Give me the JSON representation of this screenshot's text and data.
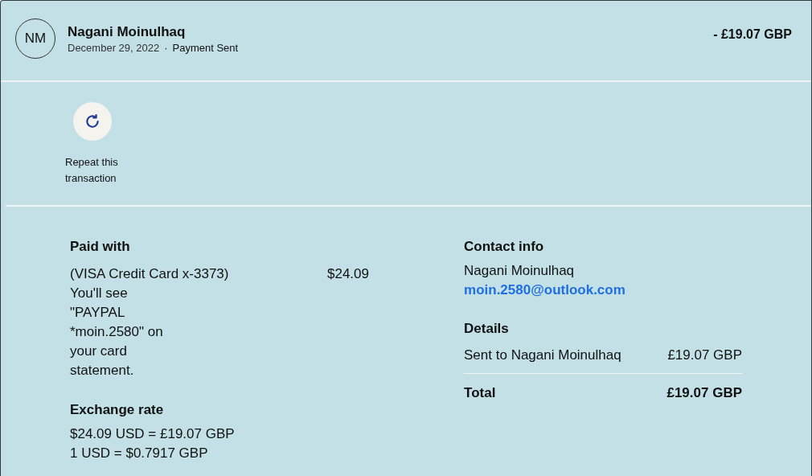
{
  "header": {
    "initials": "NM",
    "name": "Nagani Moinulhaq",
    "date": "December 29, 2022",
    "separator": "·",
    "status": "Payment Sent",
    "amount": "- £19.07 GBP"
  },
  "actions": [
    {
      "kind": "repeat",
      "label": "Repeat this transaction"
    }
  ],
  "paid_with": {
    "title": "Paid with",
    "card": "(VISA Credit Card x-3373)",
    "note": "You'll see \"PAYPAL *moin.2580\" on your card statement.",
    "amount": "$24.09"
  },
  "exchange_rate": {
    "title": "Exchange rate",
    "lines": [
      "$24.09 USD = £19.07 GBP",
      "1 USD = $0.7917 GBP"
    ]
  },
  "contact_info": {
    "title": "Contact info",
    "name": "Nagani Moinulhaq",
    "email": "moin.2580@outlook.com"
  },
  "details": {
    "title": "Details",
    "rows": [
      {
        "label": "Sent to Nagani Moinulhaq",
        "value": "£19.07 GBP"
      }
    ],
    "total": {
      "label": "Total",
      "value": "£19.07 GBP"
    }
  }
}
